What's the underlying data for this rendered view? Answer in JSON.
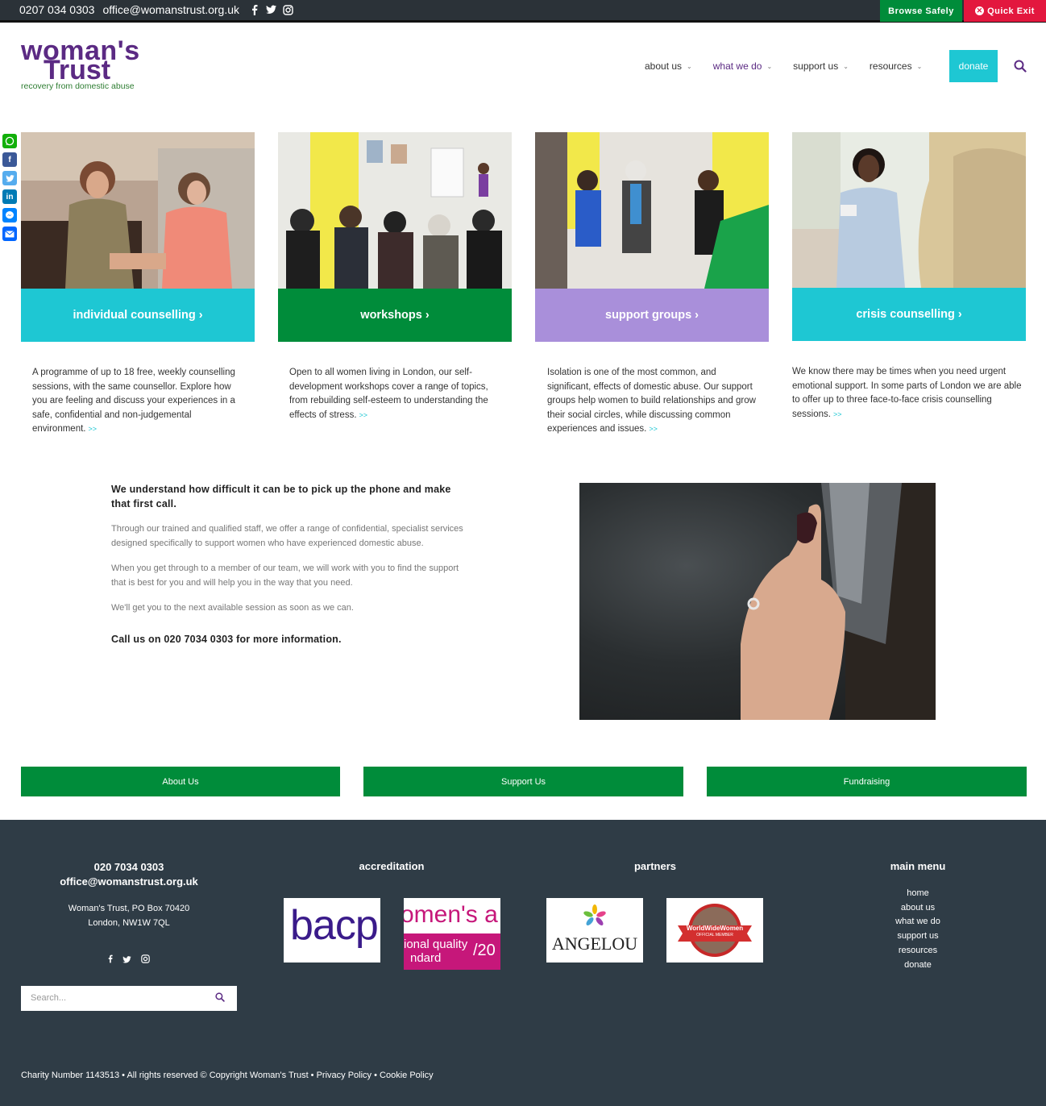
{
  "topbar": {
    "phone": "0207 034 0303",
    "email": "office@womanstrust.org.uk",
    "social_icons": [
      "facebook-icon",
      "twitter-icon",
      "instagram-icon"
    ],
    "browse_safely": "Browse Safely",
    "quick_exit": "Quick Exit"
  },
  "header": {
    "logo_line1": "woman's",
    "logo_line2": "Trust",
    "logo_tagline": "recovery from domestic abuse",
    "nav": [
      {
        "label": "about us"
      },
      {
        "label": "what we do"
      },
      {
        "label": "support us"
      },
      {
        "label": "resources"
      }
    ],
    "donate": "donate"
  },
  "share": [
    "whatsapp-icon",
    "facebook-icon",
    "twitter-icon",
    "linkedin-icon",
    "messenger-icon",
    "email-icon"
  ],
  "cards": [
    {
      "title": "individual counselling ›",
      "color": "#1ec7d3",
      "description": "A programme of up to 18 free, weekly counselling sessions, with the same counsellor. Explore how you are feeling and discuss your experiences in a safe, confidential and non-judgemental environment.",
      "more": ">>"
    },
    {
      "title": "workshops ›",
      "color": "#008c3a",
      "description": "Open to all women living in London, our self-development workshops cover a range of topics, from rebuilding self-esteem to understanding the effects of stress.",
      "more": ">>"
    },
    {
      "title": "support groups ›",
      "color": "#a98fda",
      "description": "Isolation is one of the most common, and significant, effects of domestic abuse. Our support groups help women to build relationships and grow their social circles, while discussing common experiences and issues.",
      "more": ">>"
    },
    {
      "title": "crisis counselling ›",
      "color": "#1ec7d3",
      "description": "We know there may be times when you need urgent emotional support. In some parts of London we are able to offer up to three face-to-face crisis counselling sessions.",
      "more": ">>"
    }
  ],
  "call_section": {
    "heading": "We understand how difficult it can be to pick up the phone and make that first call.",
    "p1": "Through our trained and qualified staff, we offer a range of confidential, specialist services designed specifically to support women who have experienced domestic abuse.",
    "p2": "When you get through to a member of our team, we will work with you to find the support that is best for you and will help you in the way that you need.",
    "p3": "We'll get you to the next available session as soon as we can.",
    "cta": "Call us on 020 7034 0303 for more information."
  },
  "buttons": [
    "About Us",
    "Support Us",
    "Fundraising"
  ],
  "footer": {
    "phone": "020 7034 0303",
    "email": "office@womanstrust.org.uk",
    "address1": "Woman's Trust, PO Box 70420",
    "address2": "London, NW1W 7QL",
    "search_placeholder": "Search...",
    "accreditation_title": "accreditation",
    "partners_title": "partners",
    "menu_title": "main menu",
    "bacp": "bacp",
    "womens_aid_1": "omen's a",
    "womens_aid_2": "ional quality",
    "womens_aid_3": "ndard",
    "womens_aid_4": "/20",
    "angelou": "ANGELOU",
    "wwwomen": "WorldWideWomen",
    "wwwomen_sub": "OFFICIAL MEMBER",
    "menu": [
      "home",
      "about us",
      "what we do",
      "support us",
      "resources",
      "donate"
    ],
    "copyright": "Charity Number 1143513 • All rights reserved © Copyright Woman's Trust • Privacy Policy • Cookie Policy"
  }
}
